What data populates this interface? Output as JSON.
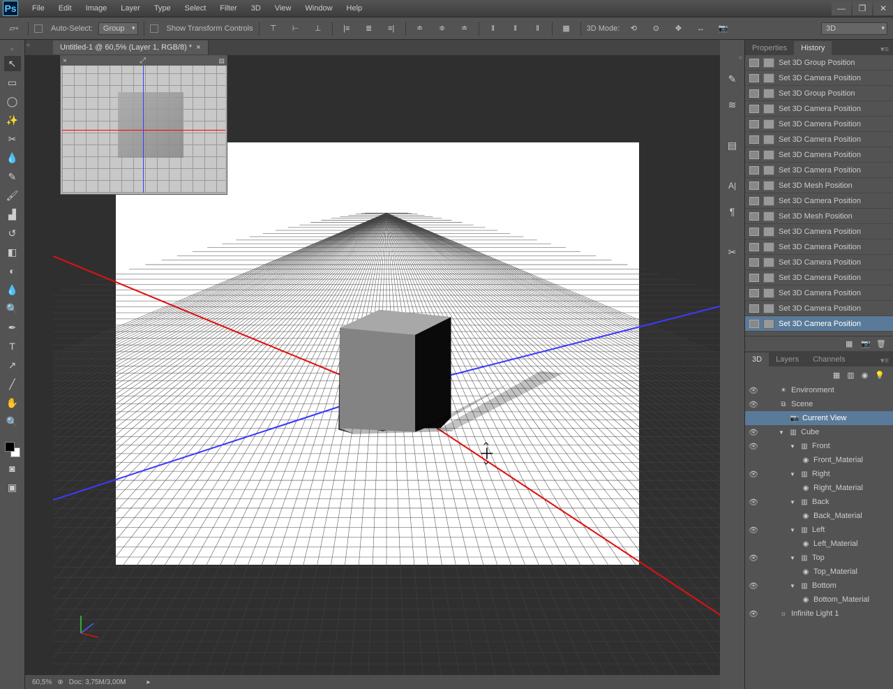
{
  "app": {
    "logo": "Ps"
  },
  "menu": [
    "File",
    "Edit",
    "Image",
    "Layer",
    "Type",
    "Select",
    "Filter",
    "3D",
    "View",
    "Window",
    "Help"
  ],
  "options": {
    "auto_select": "Auto-Select:",
    "group": "Group",
    "transform": "Show Transform Controls",
    "mode3d": "3D Mode:",
    "mode_dropdown": "3D"
  },
  "doc_tab": "Untitled-1 @ 60,5% (Layer 1, RGB/8) *",
  "zoom": "60,5%",
  "docinfo": "Doc: 3,75M/3,00M",
  "panel_tabs_top": {
    "prop": "Properties",
    "hist": "History"
  },
  "history": [
    "Set 3D Group Position",
    "Set 3D Camera Position",
    "Set 3D Group Position",
    "Set 3D Camera Position",
    "Set 3D Camera Position",
    "Set 3D Camera Position",
    "Set 3D Camera Position",
    "Set 3D Camera Position",
    "Set 3D Mesh Position",
    "Set 3D Camera Position",
    "Set 3D Mesh Position",
    "Set 3D Camera Position",
    "Set 3D Camera Position",
    "Set 3D Camera Position",
    "Set 3D Camera Position",
    "Set 3D Camera Position",
    "Set 3D Camera Position",
    "Set 3D Camera Position"
  ],
  "history_selected": 17,
  "panel_tabs_bottom": {
    "t3d": "3D",
    "layers": "Layers",
    "channels": "Channels"
  },
  "scene": {
    "env": "Environment",
    "scene": "Scene",
    "view": "Current View",
    "cube": "Cube",
    "faces": [
      {
        "name": "Front",
        "mat": "Front_Material"
      },
      {
        "name": "Right",
        "mat": "Right_Material"
      },
      {
        "name": "Back",
        "mat": "Back_Material"
      },
      {
        "name": "Left",
        "mat": "Left_Material"
      },
      {
        "name": "Top",
        "mat": "Top_Material"
      },
      {
        "name": "Bottom",
        "mat": "Bottom_Material"
      }
    ],
    "light": "Infinite Light 1"
  }
}
